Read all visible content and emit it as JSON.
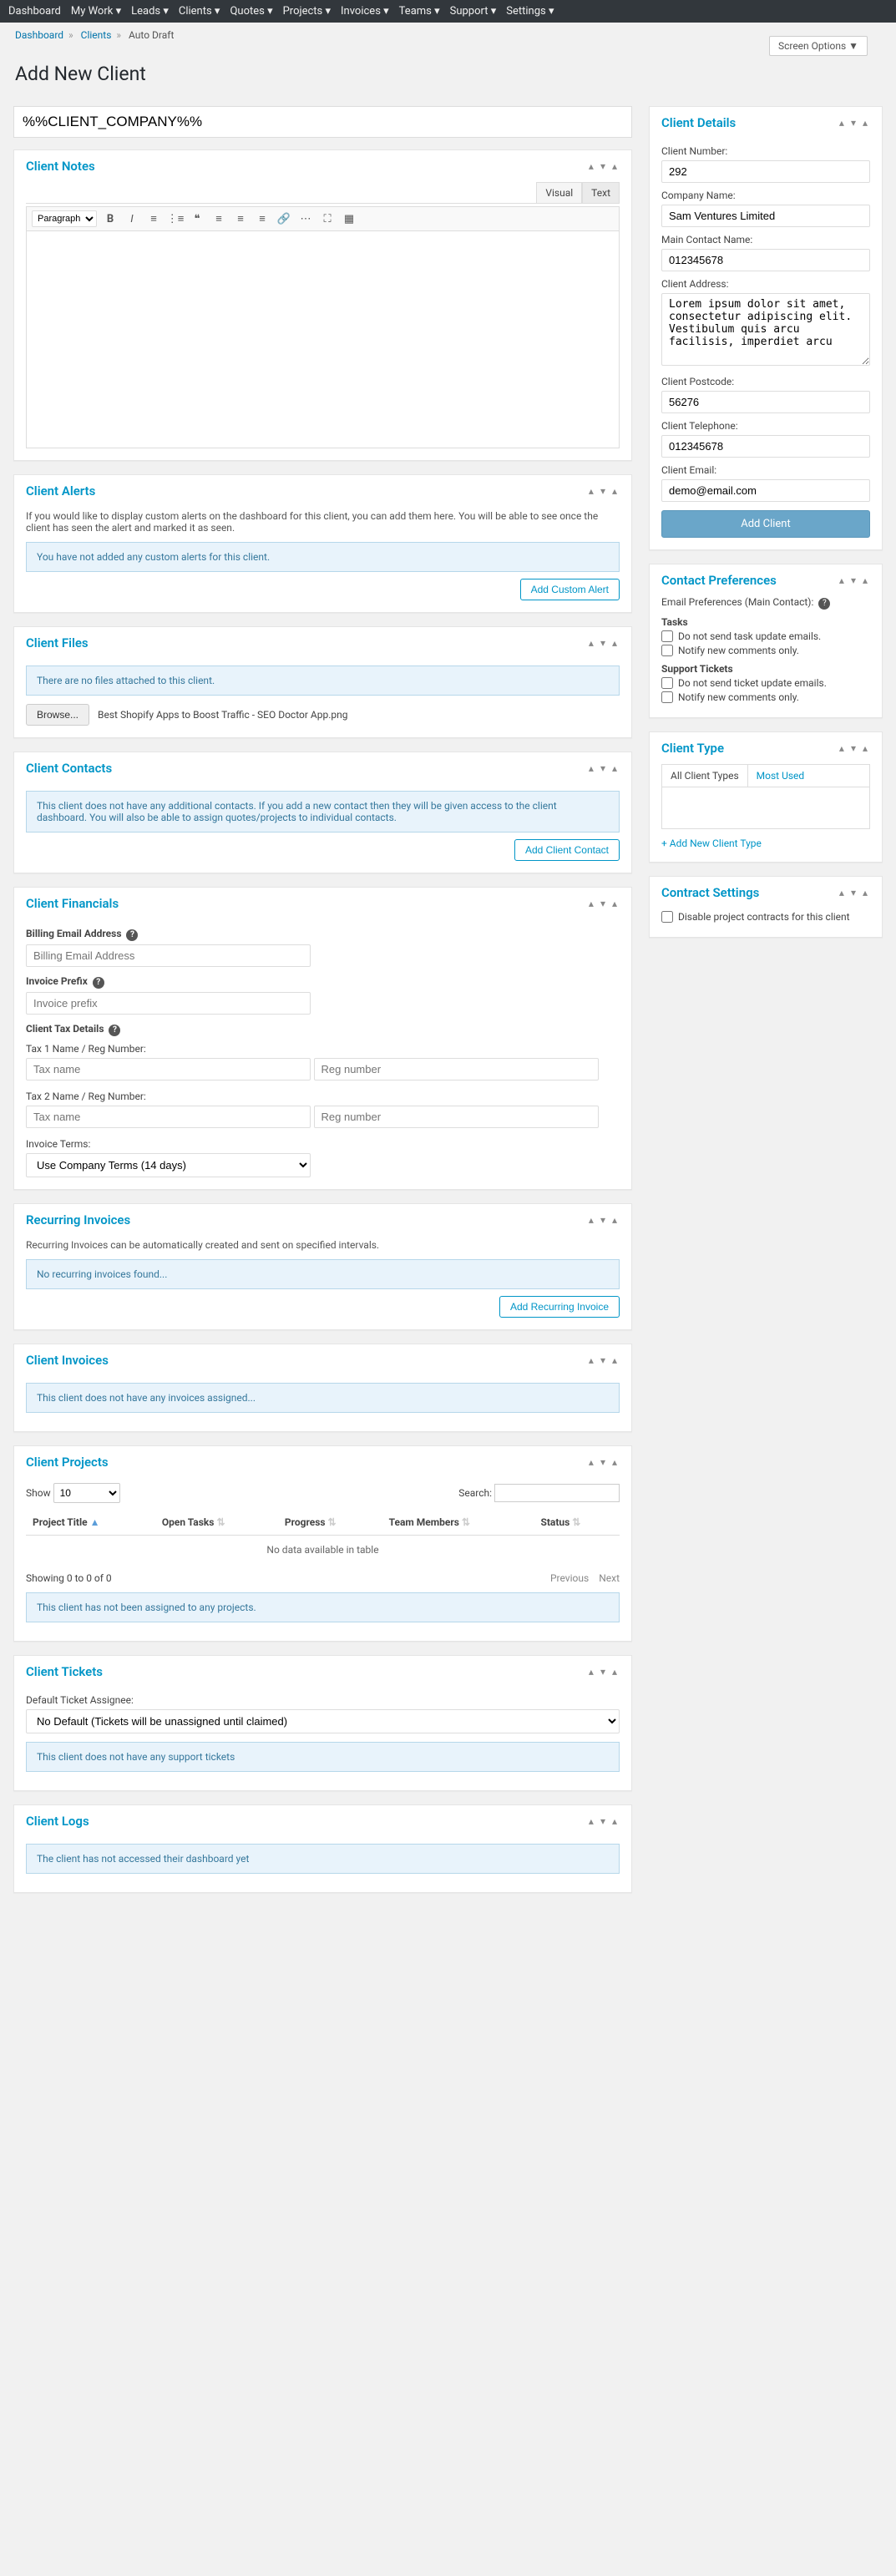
{
  "nav": [
    "Dashboard",
    "My Work",
    "Leads",
    "Clients",
    "Quotes",
    "Projects",
    "Invoices",
    "Teams",
    "Support",
    "Settings"
  ],
  "bread": {
    "a": "Dashboard",
    "b": "Clients",
    "c": "Auto Draft"
  },
  "screenOpts": "Screen Options ▼",
  "pageTitle": "Add New Client",
  "titleVal": "%%CLIENT_COMPANY%%",
  "notes": {
    "t": "Client Notes",
    "tabs": [
      "Visual",
      "Text"
    ],
    "para": "Paragraph"
  },
  "alerts": {
    "t": "Client Alerts",
    "d": "If you would like to display custom alerts on the dashboard for this client, you can add them here. You will be able to see once the client has seen the alert and marked it as seen.",
    "m": "You have not added any custom alerts for this client.",
    "b": "Add Custom Alert"
  },
  "files": {
    "t": "Client Files",
    "m": "There are no files attached to this client.",
    "b": "Browse...",
    "f": "Best Shopify Apps to Boost Traffic - SEO Doctor App.png"
  },
  "contacts": {
    "t": "Client Contacts",
    "m": "This client does not have any additional contacts. If you add a new contact then they will be given access to the client dashboard. You will also be able to assign quotes/projects to individual contacts.",
    "b": "Add Client Contact"
  },
  "fin": {
    "t": "Client Financials",
    "be": "Billing Email Address",
    "bep": "Billing Email Address",
    "ip": "Invoice Prefix",
    "ipp": "Invoice prefix",
    "td": "Client Tax Details",
    "t1": "Tax 1 Name / Reg Number:",
    "t2": "Tax 2 Name / Reg Number:",
    "tn": "Tax name",
    "rn": "Reg number",
    "it": "Invoice Terms:",
    "itv": "Use Company Terms (14 days)"
  },
  "rec": {
    "t": "Recurring Invoices",
    "d": "Recurring Invoices can be automatically created and sent on specified intervals.",
    "m": "No recurring invoices found...",
    "b": "Add Recurring Invoice"
  },
  "inv": {
    "t": "Client Invoices",
    "m": "This client does not have any invoices assigned..."
  },
  "proj": {
    "t": "Client Projects",
    "show": "Show",
    "search": "Search:",
    "cols": [
      "Project Title",
      "Open Tasks",
      "Progress",
      "Team Members",
      "Status"
    ],
    "nd": "No data available in table",
    "info": "Showing 0 to 0 of 0",
    "prev": "Previous",
    "next": "Next",
    "m": "This client has not been assigned to any projects.",
    "n": "10"
  },
  "tix": {
    "t": "Client Tickets",
    "dl": "Default Ticket Assignee:",
    "dv": "No Default (Tickets will be unassigned until claimed)",
    "m": "This client does not have any support tickets"
  },
  "logs": {
    "t": "Client Logs",
    "m": "The client has not accessed their dashboard yet"
  },
  "details": {
    "t": "Client Details",
    "cn": "Client Number:",
    "cnv": "292",
    "co": "Company Name:",
    "cov": "Sam Ventures Limited",
    "mc": "Main Contact Name:",
    "mcv": "012345678",
    "ca": "Client Address:",
    "cav": "Lorem ipsum dolor sit amet, consectetur adipiscing elit. Vestibulum quis arcu facilisis, imperdiet arcu",
    "cp": "Client Postcode:",
    "cpv": "56276",
    "ct": "Client Telephone:",
    "ctv": "012345678",
    "ce": "Client Email:",
    "cev": "demo@email.com",
    "b": "Add Client"
  },
  "pref": {
    "t": "Contact Preferences",
    "ep": "Email Preferences (Main Contact):",
    "tk": "Tasks",
    "c1": "Do not send task update emails.",
    "c2": "Notify new comments only.",
    "st": "Support Tickets",
    "c3": "Do not send ticket update emails.",
    "c4": "Notify new comments only."
  },
  "ctype": {
    "t": "Client Type",
    "a": "All Client Types",
    "b": "Most Used",
    "add": "+ Add New Client Type"
  },
  "cset": {
    "t": "Contract Settings",
    "c": "Disable project contracts for this client"
  }
}
